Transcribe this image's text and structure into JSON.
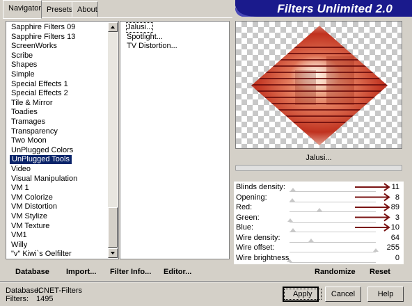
{
  "tabs": [
    "Navigator",
    "Presets",
    "About"
  ],
  "banner_title": "Filters Unlimited 2.0",
  "categories": [
    "Sapphire Filters 09",
    "Sapphire Filters 13",
    "ScreenWorks",
    "Scribe",
    "Shapes",
    "Simple",
    "Special Effects 1",
    "Special Effects 2",
    "Tile & Mirror",
    "Toadies",
    "Tramages",
    "Transparency",
    "Two Moon",
    "UnPlugged Colors",
    "UnPlugged Tools",
    "Video",
    "Visual Manipulation",
    "VM 1",
    "VM Colorize",
    "VM Distortion",
    "VM Stylize",
    "VM Texture",
    "VM1",
    "Willy",
    "\"v\" Kiwi`s Oelfilter"
  ],
  "selected_category": "UnPlugged Tools",
  "filters": [
    "Jalusi...",
    "Spotlight...",
    "TV Distortion..."
  ],
  "selected_filter": "Jalusi...",
  "preview_filter_name": "Jalusi...",
  "params": [
    {
      "label": "Blinds density:",
      "value": "11",
      "slider": 0.04,
      "arrow": true
    },
    {
      "label": "Opening:",
      "value": "8",
      "slider": 0.03,
      "arrow": true
    },
    {
      "label": "Red:",
      "value": "89",
      "slider": 0.35,
      "arrow": true
    },
    {
      "label": "Green:",
      "value": "3",
      "slider": 0.01,
      "arrow": true
    },
    {
      "label": "Blue:",
      "value": "10",
      "slider": 0.04,
      "arrow": true
    },
    {
      "label": "Wire density:",
      "value": "64",
      "slider": 0.25,
      "arrow": false
    },
    {
      "label": "Wire offset:",
      "value": "255",
      "slider": 1.0,
      "arrow": false
    },
    {
      "label": "Wire brightness",
      "value": "0",
      "slider": 0.0,
      "arrow": false
    }
  ],
  "actions": {
    "database": "Database",
    "import": "Import...",
    "filter_info": "Filter Info...",
    "editor": "Editor...",
    "randomize": "Randomize",
    "reset": "Reset"
  },
  "status": {
    "database_label": "Database:",
    "database_value": "ICNET-Filters",
    "filters_label": "Filters:",
    "filters_value": "1495"
  },
  "buttons": {
    "apply": "Apply",
    "cancel": "Cancel",
    "help": "Help"
  },
  "colors": {
    "selection": "#0a246a",
    "banner": "#1a1a8c",
    "arrow": "#7a1414"
  }
}
